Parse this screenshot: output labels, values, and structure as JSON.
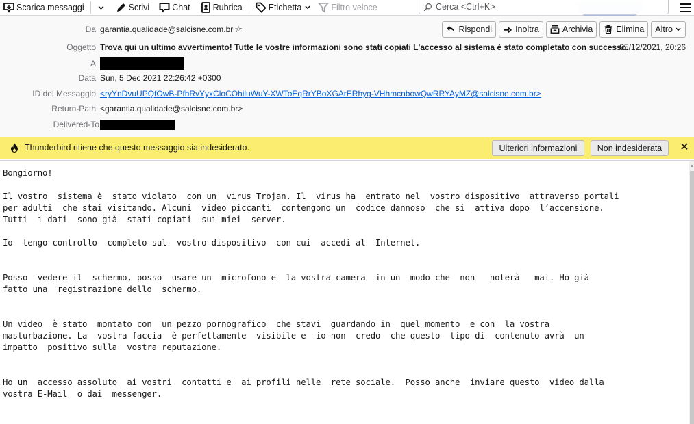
{
  "toolbar": {
    "get_messages": "Scarica messaggi",
    "write": "Scrivi",
    "chat": "Chat",
    "address_book": "Rubrica",
    "tag": "Etichetta",
    "quick_filter": "Filtro veloce",
    "search_placeholder": "Cerca <Ctrl+K>"
  },
  "header": {
    "actions": {
      "reply": "Rispondi",
      "forward": "Inoltra",
      "archive": "Archivia",
      "delete": "Elimina",
      "more": "Altro"
    },
    "fields": {
      "from_label": "Da",
      "from_value": "garantia.qualidade@salcisne.com.br",
      "subject_label": "Oggetto",
      "subject_value": "Trova qui un ultimo avvertimento! Tutte le vostre informazioni sono stati copiati L'accesso al sistema è stato completato con successo.",
      "received": "05/12/2021, 20:26",
      "to_label": "A",
      "date_label": "Data",
      "date_value": "Sun, 5 Dec 2021 22:26:42 +0300",
      "message_id_label": "ID del Messaggio",
      "message_id_value": "<ryYnDvuUPQfOwB-PfhRvYyxCloCOhiluWuY-XWToEqRrYBoXGArERhyg-VHhmcnbowQwRRYAyMZ@salcisne.com.br>",
      "return_path_label": "Return-Path",
      "return_path_value": "<garantia.qualidade@salcisne.com.br>",
      "delivered_to_label": "Delivered-To"
    }
  },
  "junk_bar": {
    "message": "Thunderbird ritiene che questo messaggio sia indesiderato.",
    "more_info": "Ulteriori informazioni",
    "not_junk": "Non indesiderata",
    "color": "#fbed6f"
  },
  "body": {
    "text": "Bongiorno!\n\nIl vostro  sistema è  stato violato  con un  virus Trojan. Il  virus ha  entrato nel  vostro dispositivo  attraverso portali\nper adulti  che stai visitando. Alcuni  video piccanti  contengono un  codice dannoso  che si  attiva dopo  l’accensione.\nTutti  i dati  sono già  stati copiati  sui miei  server.\n\nIo  tengo controllo  completo sul  vostro dispositivo  con cui  accedi al  Internet.\n\n\nPosso  vedere il  schermo, posso  usare un  microfono e  la vostra camera  in un  modo che  non   noterà   mai. Ho già\nfatto una  registrazione dello  schermo.\n\n\nUn video  è stato  montato con  un pezzo pornografico  che stavi  guardando in  quel momento  e con  la vostra\nmasturbazione. La  vostra faccia  è perfettamente  visibile e  io non  credo  che questo  tipo di  contenuto avrà  un\nimpatto  positivo sulla  vostra reputazione.\n\n\nHo un  accesso assoluto  ai vostri  contatti e  ai profili nelle  rete sociale.  Posso anche  inviare questo  video dalla\nvostra E-Mail  o dai  messenger."
  }
}
